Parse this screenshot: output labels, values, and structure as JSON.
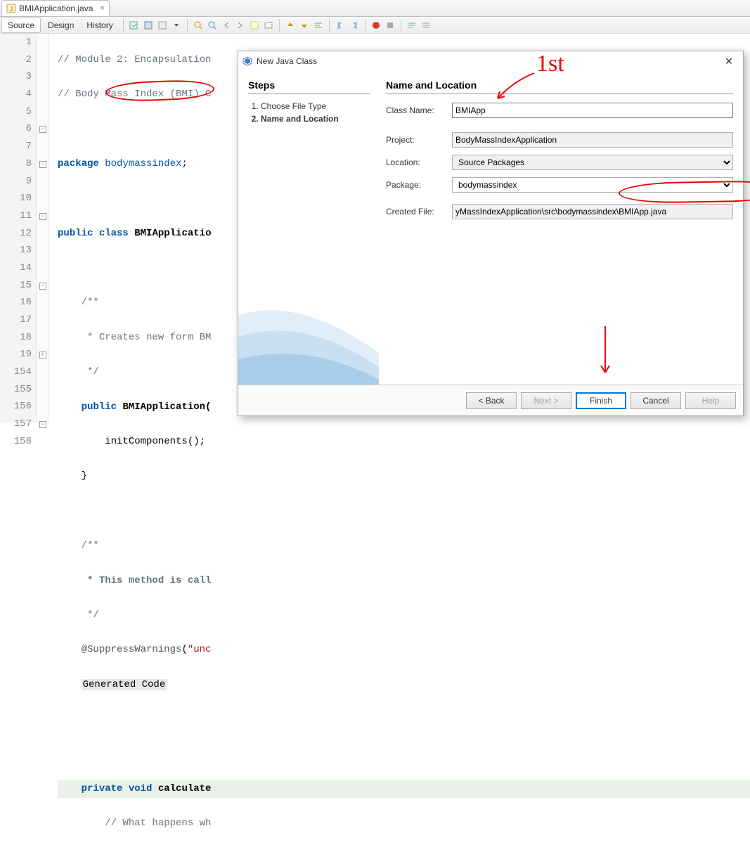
{
  "editor": {
    "file_tab_label": "BMIApplication.java",
    "view_tabs": {
      "source": "Source",
      "design": "Design",
      "history": "History"
    },
    "gutter_lines": [
      "1",
      "2",
      "3",
      "4",
      "5",
      "6",
      "7",
      "8",
      "9",
      "10",
      "11",
      "12",
      "13",
      "14",
      "15",
      "16",
      "17",
      "18",
      "19",
      "154",
      "155",
      "156",
      "157",
      "158"
    ],
    "code": {
      "l1": "// Module 2: Encapsulation",
      "l2": "// Body Mass Index (BMI) C",
      "l4_kw": "package",
      "l4_pkg": "bodymassindex",
      "l4_semi": ";",
      "l6a": "public",
      "l6b": "class",
      "l6c": "BMIApplicatio",
      "l8": "/**",
      "l9": " * Creates new form BM",
      "l10": " */",
      "l11a": "public",
      "l11b": "BMIApplication(",
      "l12": "initComponents();",
      "l13": "}",
      "l15": "/**",
      "l16": " * This method is call",
      "l17": " */",
      "l18a": "@SuppressWarnings",
      "l18b": "(",
      "l18c": "\"unc",
      "l19": "Generated Code",
      "l157a": "private",
      "l157b": "void",
      "l157c": "calculate",
      "l158": "// What happens wh"
    }
  },
  "dialog": {
    "title": "New Java Class",
    "steps_heading": "Steps",
    "step1": "Choose File Type",
    "step2": "Name and Location",
    "right_heading": "Name and Location",
    "labels": {
      "class_name": "Class Name:",
      "project": "Project:",
      "location": "Location:",
      "package": "Package:",
      "created_file": "Created File:"
    },
    "values": {
      "class_name": "BMIApp",
      "project": "BodyMassIndexApplication",
      "location": "Source Packages",
      "package": "bodymassindex",
      "created_file": "yMassIndexApplication\\src\\bodymassindex\\BMIApp.java"
    },
    "buttons": {
      "back": "< Back",
      "next": "Next >",
      "finish": "Finish",
      "cancel": "Cancel",
      "help": "Help"
    }
  },
  "annotations": {
    "first": "1st"
  }
}
